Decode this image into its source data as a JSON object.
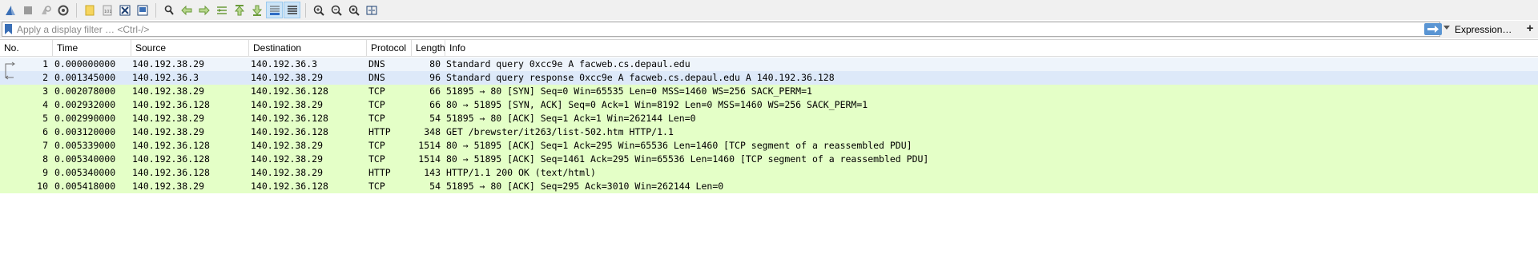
{
  "toolbar": {
    "icons": [
      "shark-fin-start-icon",
      "stop-capture-icon",
      "restart-capture-icon",
      "capture-options-icon",
      "open-file-icon",
      "save-file-icon",
      "close-file-icon",
      "reload-file-icon",
      "find-packet-icon",
      "go-back-icon",
      "go-forward-icon",
      "go-to-packet-icon",
      "first-packet-icon",
      "last-packet-icon",
      "auto-scroll-icon",
      "colorize-icon",
      "zoom-in-icon",
      "zoom-out-icon",
      "normal-size-icon",
      "resize-columns-icon"
    ]
  },
  "filter": {
    "placeholder": "Apply a display filter … <Ctrl-/>",
    "value": "",
    "expression_label": "Expression…",
    "add_label": "+"
  },
  "columns": [
    "No.",
    "Time",
    "Source",
    "Destination",
    "Protocol",
    "Length",
    "Info"
  ],
  "colors": {
    "udp_row": "#dae8fc",
    "tcp_row": "#e4ffc7",
    "selected_row": "#dbe9f8",
    "first_row": "#e8f1fc"
  },
  "packets": [
    {
      "no": "1",
      "time": "0.000000000",
      "source": "140.192.38.29",
      "destination": "140.192.36.3",
      "protocol": "DNS",
      "length": "80",
      "info": "Standard query 0xcc9e A facweb.cs.depaul.edu",
      "color": "#eef4fb"
    },
    {
      "no": "2",
      "time": "0.001345000",
      "source": "140.192.36.3",
      "destination": "140.192.38.29",
      "protocol": "DNS",
      "length": "96",
      "info": "Standard query response 0xcc9e A facweb.cs.depaul.edu A 140.192.36.128",
      "color": "#dde9f9"
    },
    {
      "no": "3",
      "time": "0.002078000",
      "source": "140.192.38.29",
      "destination": "140.192.36.128",
      "protocol": "TCP",
      "length": "66",
      "info": "51895 → 80 [SYN] Seq=0 Win=65535 Len=0 MSS=1460 WS=256 SACK_PERM=1",
      "color": "#e4ffc7"
    },
    {
      "no": "4",
      "time": "0.002932000",
      "source": "140.192.36.128",
      "destination": "140.192.38.29",
      "protocol": "TCP",
      "length": "66",
      "info": "80 → 51895 [SYN, ACK] Seq=0 Ack=1 Win=8192 Len=0 MSS=1460 WS=256 SACK_PERM=1",
      "color": "#e4ffc7"
    },
    {
      "no": "5",
      "time": "0.002990000",
      "source": "140.192.38.29",
      "destination": "140.192.36.128",
      "protocol": "TCP",
      "length": "54",
      "info": "51895 → 80 [ACK] Seq=1 Ack=1 Win=262144 Len=0",
      "color": "#e4ffc7"
    },
    {
      "no": "6",
      "time": "0.003120000",
      "source": "140.192.38.29",
      "destination": "140.192.36.128",
      "protocol": "HTTP",
      "length": "348",
      "info": "GET /brewster/it263/list-502.htm HTTP/1.1",
      "color": "#e4ffc7"
    },
    {
      "no": "7",
      "time": "0.005339000",
      "source": "140.192.36.128",
      "destination": "140.192.38.29",
      "protocol": "TCP",
      "length": "1514",
      "info": "80 → 51895 [ACK] Seq=1 Ack=295 Win=65536 Len=1460 [TCP segment of a reassembled PDU]",
      "color": "#e4ffc7"
    },
    {
      "no": "8",
      "time": "0.005340000",
      "source": "140.192.36.128",
      "destination": "140.192.38.29",
      "protocol": "TCP",
      "length": "1514",
      "info": "80 → 51895 [ACK] Seq=1461 Ack=295 Win=65536 Len=1460 [TCP segment of a reassembled PDU]",
      "color": "#e4ffc7"
    },
    {
      "no": "9",
      "time": "0.005340000",
      "source": "140.192.36.128",
      "destination": "140.192.38.29",
      "protocol": "HTTP",
      "length": "143",
      "info": "HTTP/1.1 200 OK  (text/html)",
      "color": "#e4ffc7"
    },
    {
      "no": "10",
      "time": "0.005418000",
      "source": "140.192.38.29",
      "destination": "140.192.36.128",
      "protocol": "TCP",
      "length": "54",
      "info": "51895 → 80 [ACK] Seq=295 Ack=3010 Win=262144 Len=0",
      "color": "#e4ffc7"
    }
  ]
}
